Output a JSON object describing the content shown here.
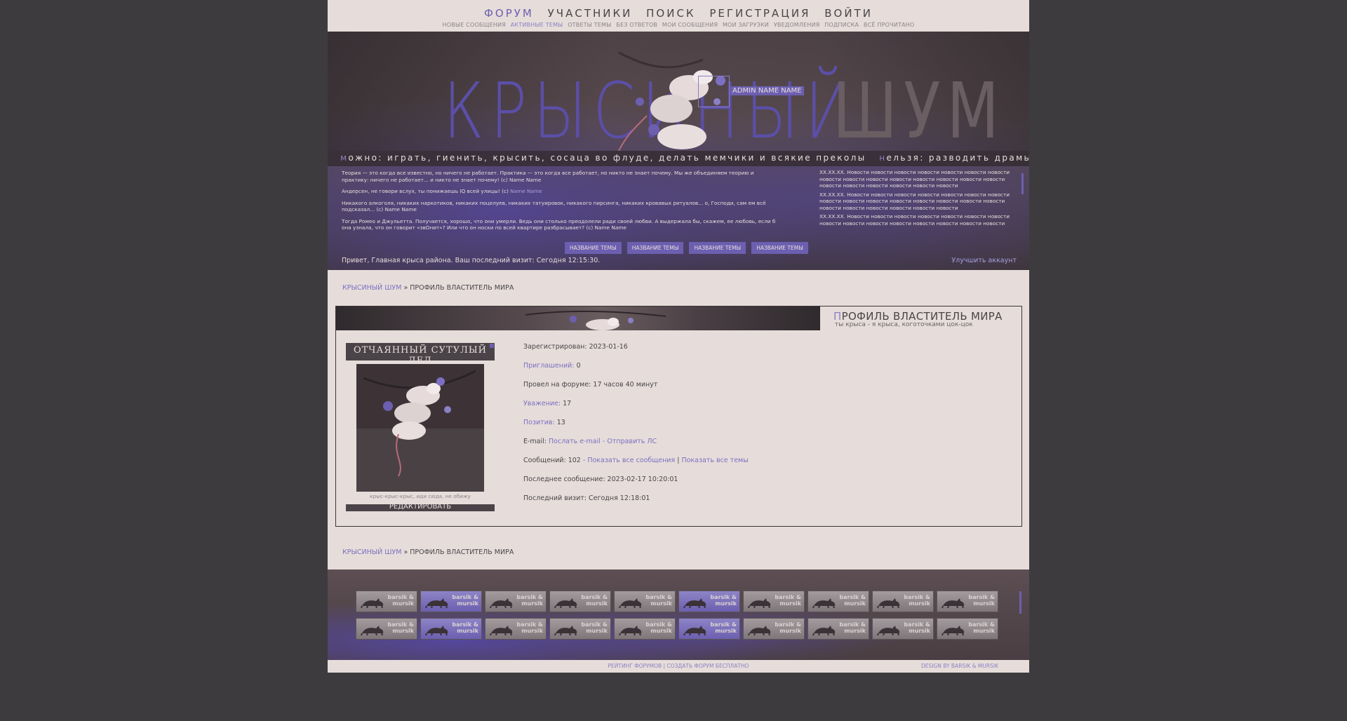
{
  "nav": {
    "main": [
      {
        "label": "ФОРУМ",
        "active": true
      },
      {
        "label": "УЧАСТНИКИ",
        "active": false
      },
      {
        "label": "ПОИСК",
        "active": false
      },
      {
        "label": "РЕГИСТРАЦИЯ",
        "active": false
      },
      {
        "label": "ВОЙТИ",
        "active": false
      }
    ],
    "sub": [
      {
        "label": "НОВЫЕ СООБЩЕНИЯ",
        "active": false
      },
      {
        "label": "АКТИВНЫЕ ТЕМЫ",
        "active": true
      },
      {
        "label": "ОТВЕТЫ ТЕМЫ",
        "active": false
      },
      {
        "label": "БЕЗ ОТВЕТОВ",
        "active": false
      },
      {
        "label": "МОИ СООБЩЕНИЯ",
        "active": false
      },
      {
        "label": "МОИ ЗАГРУЗКИ",
        "active": false
      },
      {
        "label": "УВЕДОМЛЕНИЯ",
        "active": false
      },
      {
        "label": "ПОДПИСКА",
        "active": false
      },
      {
        "label": "ВСЁ ПРОЧИТАНО",
        "active": false
      }
    ]
  },
  "header": {
    "logo_part1": "КРЫСИНЫЙ",
    "logo_part2": "ШУМ",
    "admin_name": "ADMIN NAME NAME",
    "rules_can_first": "м",
    "rules_can": "ожно: играть, гиенить, крысить, сосаца во флуде, делать мемчики и всякие преколы",
    "rules_cannot_first": "н",
    "rules_cannot": "ельзя: разводить драмы",
    "quotes": [
      {
        "text": "Теория — это когда все известно, но ничего не работает. Практика — это когда все работает, но никто не знает почему. Мы же объединяем теорию и практику: ничего не работает... и никто не знает почему! (c) Name Name",
        "name": ""
      },
      {
        "text": "Андерсен, не говори вслух, ты понижаешь IQ всей улицы! (c)",
        "name": "Name Name"
      },
      {
        "text": "Никакого алкоголя, никаких наркотиков, никаких поцелуев, никаких татуировок, никакого пирсинга, никаких кровавых ритуалов... о, Господи, сам ем всё подсказал... (c) Name Name",
        "name": ""
      },
      {
        "text": "Тогда Ромео и Джульетта. Получается, хорошо, что они умерли. Ведь они столько преодолели ради своей любви. А выдержала бы, скажем, ее любовь, если б она узнала, что он говорит «звОнит»? Или что он носки по всей квартире разбрасывает? (c) Name Name",
        "name": ""
      }
    ],
    "topic_buttons": [
      "НАЗВАНИЕ ТЕМЫ",
      "НАЗВАНИЕ ТЕМЫ",
      "НАЗВАНИЕ ТЕМЫ",
      "НАЗВАНИЕ ТЕМЫ"
    ],
    "news": [
      "XX.XX.XX. Новости новости новости новости новости новости новости новости новости новости новости новости новости новости новости новости новости новости новости новости новости",
      "XX.XX.XX. Новости новости новости новости новости новости новости новости новости новости новости новости новости новости новости новости новости новости новости новости новости",
      "XX.XX.XX. Новости новости новости новости новости новости новости новости новости новости новости новости новости новости новости новости новости новости новости новости новости"
    ],
    "welcome": "Привет, Главная крыса района. Ваш последний визит: Сегодня 12:15:30.",
    "upgrade": "Улучшить аккаунт"
  },
  "breadcrumb": {
    "root": "КРЫСИНЫЙ ШУМ",
    "sep": "»",
    "current": "ПРОФИЛЬ ВЛАСТИТЕЛЬ МИРА"
  },
  "profile": {
    "title_first": "П",
    "title_rest": "РОФИЛЬ ВЛАСТИТЕЛЬ МИРА",
    "subtitle": "ты крыса - я крыса, коготочками цок-цок",
    "card_name": "ОТЧАЯННЫЙ СУТУЛЫЙ ДЕД",
    "card_caption": "крыс-крыс-крыс, иди сюда, не обижу",
    "edit_label": "РЕДАКТИРОВАТЬ",
    "stats": {
      "registered_label": "Зарегистрирован:",
      "registered_value": "2023-01-16",
      "invites_label": "Приглашений:",
      "invites_value": "0",
      "time_label": "Провел на форуме:",
      "time_value": "17 часов 40 минут",
      "respect_label": "Уважение:",
      "respect_value": "17",
      "positive_label": "Позитив:",
      "positive_value": "13",
      "email_label": "E-mail:",
      "email_link": "Послать e-mail",
      "email_dash": "-",
      "pm_link": "Отправить ЛС",
      "posts_label": "Сообщений:",
      "posts_value": "102",
      "posts_dash": "-",
      "posts_link1": "Показать все сообщения",
      "posts_sep": "|",
      "posts_link2": "Показать все темы",
      "last_post_label": "Последнее сообщение:",
      "last_post_value": "2023-02-17 10:20:01",
      "last_visit_label": "Последний визит:",
      "last_visit_value": "Сегодня 12:18:01"
    }
  },
  "banners": {
    "text_line1": "barsik &",
    "text_line2": "mursik"
  },
  "footer": {
    "center": "РЕЙТИНГ ФОРУМОВ | СОЗДАТЬ ФОРУМ БЕСПЛАТНО",
    "right": "DESIGN BY BARSIK & MURSIK"
  }
}
